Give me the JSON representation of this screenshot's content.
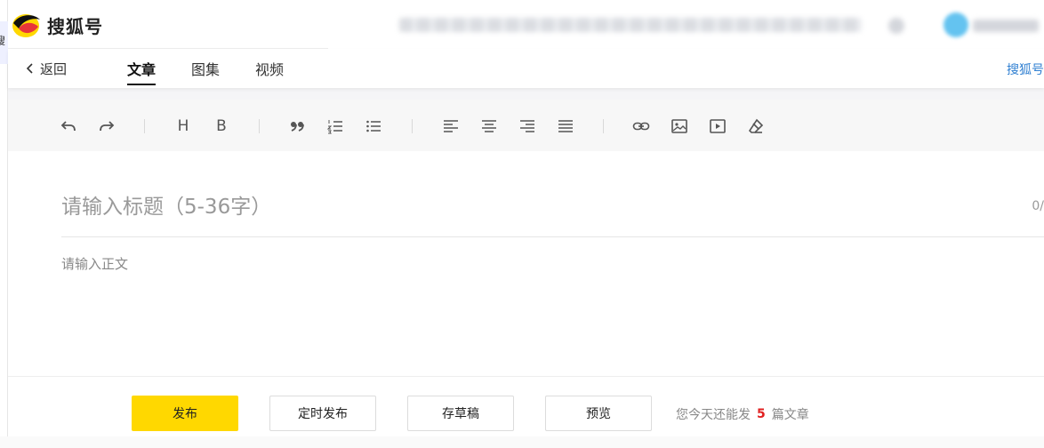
{
  "left_sliver": {
    "char": "搜"
  },
  "header": {
    "brand": "搜狐号",
    "colors": {
      "brand_yellow": "#ffd800",
      "brand_red": "#e8353a",
      "brand_black": "#111111"
    }
  },
  "nav": {
    "back_label": "返回",
    "tabs": [
      {
        "label": "文章",
        "active": true
      },
      {
        "label": "图集",
        "active": false
      },
      {
        "label": "视频",
        "active": false
      }
    ],
    "right_link": "搜狐号"
  },
  "toolbar": {
    "buttons": [
      {
        "name": "undo",
        "icon": "undo-icon"
      },
      {
        "name": "redo",
        "icon": "redo-icon"
      },
      {
        "name": "heading",
        "glyph": "H"
      },
      {
        "name": "bold",
        "glyph": "B"
      },
      {
        "name": "quote",
        "icon": "quote-icon"
      },
      {
        "name": "ordered-list",
        "icon": "ordered-list-icon"
      },
      {
        "name": "bullet-list",
        "icon": "bullet-list-icon"
      },
      {
        "name": "align-left",
        "icon": "align-left-icon"
      },
      {
        "name": "align-center",
        "icon": "align-center-icon"
      },
      {
        "name": "align-right",
        "icon": "align-right-icon"
      },
      {
        "name": "align-justify",
        "icon": "align-justify-icon"
      },
      {
        "name": "link",
        "icon": "link-icon"
      },
      {
        "name": "image",
        "icon": "image-icon"
      },
      {
        "name": "video",
        "icon": "video-icon"
      },
      {
        "name": "clear-format",
        "icon": "eraser-icon"
      }
    ]
  },
  "editor": {
    "title_placeholder": "请输入标题（5-36字）",
    "title_value": "",
    "title_counter": "0/",
    "body_placeholder": "请输入正文",
    "body_value": ""
  },
  "footer": {
    "publish_label": "发布",
    "schedule_label": "定时发布",
    "draft_label": "存草稿",
    "preview_label": "预览",
    "quota_prefix": "您今天还能发",
    "quota_count": "5",
    "quota_suffix": "篇文章"
  }
}
